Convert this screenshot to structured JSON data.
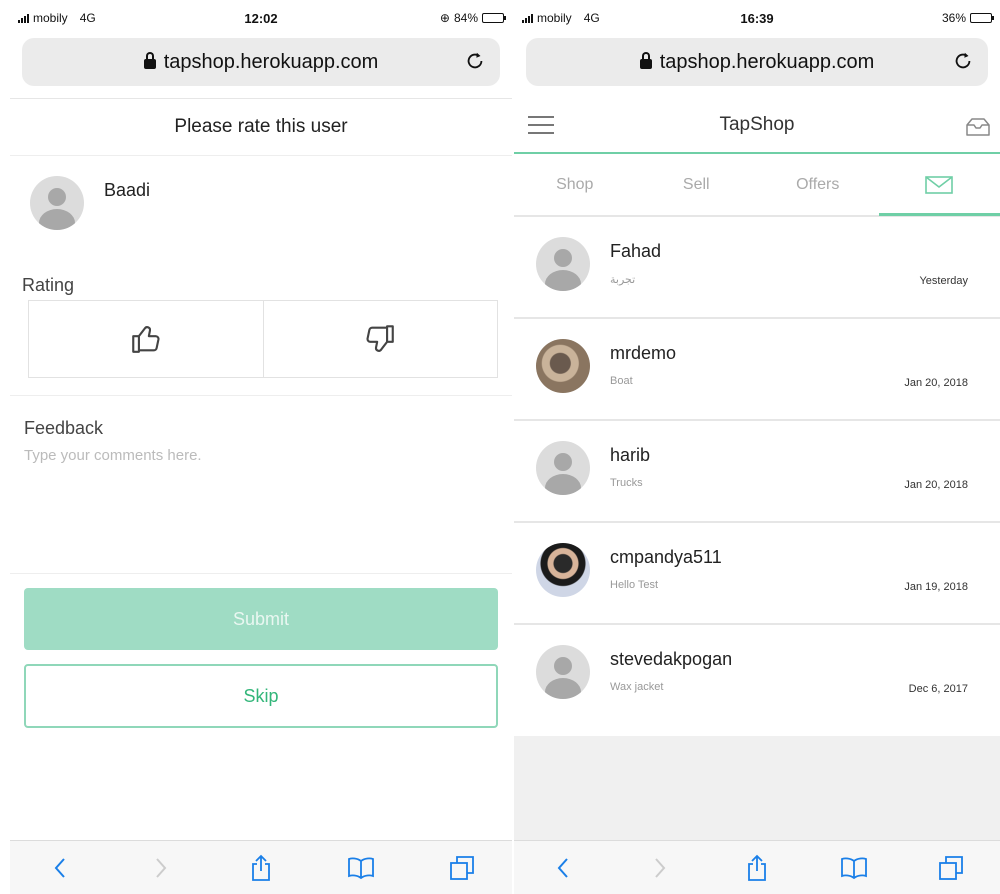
{
  "left": {
    "status": {
      "carrier": "mobily",
      "network": "4G",
      "time": "12:02",
      "battery": "84%",
      "battery_level": 0.84
    },
    "url": "tapshop.herokuapp.com",
    "page_title": "Please rate this user",
    "user": {
      "name": "Baadi"
    },
    "rating_label": "Rating",
    "feedback_label": "Feedback",
    "feedback_placeholder": "Type your comments here.",
    "submit_label": "Submit",
    "skip_label": "Skip"
  },
  "right": {
    "status": {
      "carrier": "mobily",
      "network": "4G",
      "time": "16:39",
      "battery": "36%",
      "battery_level": 0.36
    },
    "url": "tapshop.herokuapp.com",
    "app_title": "TapShop",
    "tabs": [
      "Shop",
      "Sell",
      "Offers"
    ],
    "messages": [
      {
        "name": "Fahad",
        "snippet": "تجربة",
        "date": "Yesterday",
        "avatar": "default-avatar"
      },
      {
        "name": "mrdemo",
        "snippet": "Boat",
        "date": "Jan 20, 2018",
        "avatar": "photo"
      },
      {
        "name": "harib",
        "snippet": "Trucks",
        "date": "Jan 20, 2018",
        "avatar": "default-avatar"
      },
      {
        "name": "cmpandya511",
        "snippet": "Hello Test",
        "date": "Jan 19, 2018",
        "avatar": "photo"
      },
      {
        "name": "stevedakpogan",
        "snippet": "Wax jacket",
        "date": "Dec 6, 2017",
        "avatar": "default-avatar"
      }
    ]
  },
  "colors": {
    "accent": "#6fcfa6",
    "submit_bg": "#9fdcc4",
    "skip_text": "#33b67a"
  },
  "icons": {
    "toolbar": [
      "back-icon",
      "forward-icon",
      "share-icon",
      "bookmarks-icon",
      "tabs-icon"
    ],
    "rating": [
      "thumbs-up-icon",
      "thumbs-down-icon"
    ]
  }
}
